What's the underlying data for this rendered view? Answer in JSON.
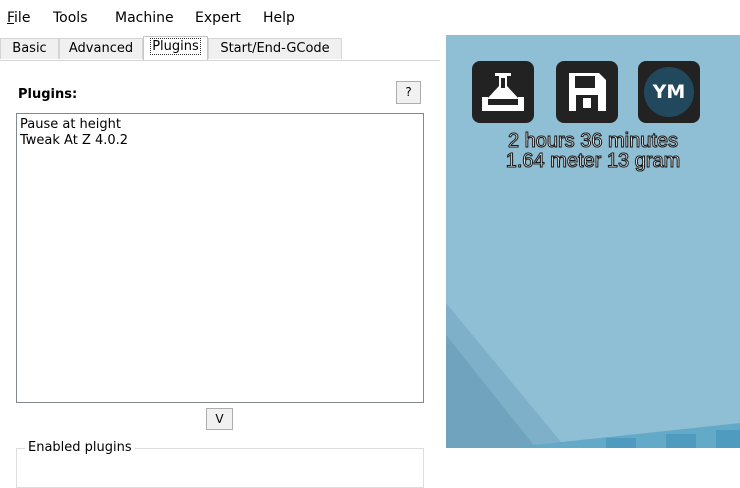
{
  "menu": {
    "items": [
      {
        "mnemonic": "F",
        "rest": "ile"
      },
      {
        "mnemonic": "",
        "rest": "Tools"
      },
      {
        "mnemonic": "",
        "rest": "Machine"
      },
      {
        "mnemonic": "",
        "rest": "Expert"
      },
      {
        "mnemonic": "",
        "rest": "Help"
      }
    ]
  },
  "tabs": [
    {
      "label": "Basic",
      "active": false
    },
    {
      "label": "Advanced",
      "active": false
    },
    {
      "label": "Plugins",
      "active": true
    },
    {
      "label": "Start/End-GCode",
      "active": false
    }
  ],
  "plugins_panel": {
    "title": "Plugins:",
    "help_label": "?",
    "items": [
      "Pause at height",
      "Tweak At Z 4.0.2"
    ],
    "add_button_label": "V",
    "enabled_group_label": "Enabled plugins"
  },
  "viewport": {
    "background_color": "#8fbfd5",
    "buttons": [
      {
        "icon": "load-model-icon"
      },
      {
        "icon": "save-floppy-icon"
      },
      {
        "icon": "youmagine-icon",
        "label": "YM"
      }
    ],
    "print_time": "2 hours 36 minutes",
    "print_material": "1.64 meter 13 gram"
  }
}
